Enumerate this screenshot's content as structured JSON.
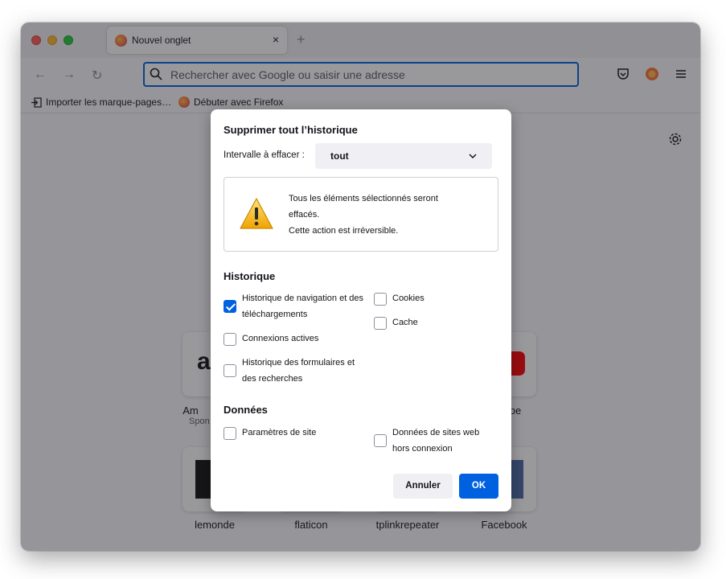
{
  "browser": {
    "tab_title": "Nouvel onglet",
    "tab_close": "×",
    "new_tab": "+",
    "back": "←",
    "forward": "→",
    "reload": "↻",
    "url_placeholder": "Rechercher avec Google ou saisir une adresse",
    "accent": "#0061e0"
  },
  "bookmarks": {
    "import": "Importer les marque-pages…",
    "getting_started": "Débuter avec Firefox"
  },
  "newtab": {
    "tiles_row1": [
      {
        "label": "Am",
        "sub": "Spon"
      },
      {
        "label": "be",
        "sub": ""
      }
    ],
    "tiles_row2": [
      {
        "label": "lemonde"
      },
      {
        "label": "flaticon"
      },
      {
        "label": "tplinkrepeater"
      },
      {
        "label": "Facebook"
      }
    ]
  },
  "dialog": {
    "title": "Supprimer tout l’historique",
    "range_label": "Intervalle à effacer :",
    "range_value": "tout",
    "warning_line1": "Tous les éléments sélectionnés seront",
    "warning_line2": "effacés.",
    "warning_line3": "Cette action est irréversible.",
    "history_heading": "Historique",
    "history_items": [
      {
        "line1": "Historique de navigation et des",
        "line2": "téléchargements",
        "checked": true
      },
      {
        "line1": "Connexions actives",
        "line2": "",
        "checked": false
      },
      {
        "line1": "Historique des formulaires et",
        "line2": "des recherches",
        "checked": false
      },
      {
        "line1": "Cookies",
        "line2": "",
        "checked": false
      },
      {
        "line1": "Cache",
        "line2": "",
        "checked": false
      }
    ],
    "data_heading": "Données",
    "data_items": [
      {
        "line1": "Paramètres de site",
        "line2": "",
        "checked": false
      },
      {
        "line1": "Données de sites web",
        "line2": "hors connexion",
        "checked": false
      }
    ],
    "cancel": "Annuler",
    "ok": "OK"
  }
}
